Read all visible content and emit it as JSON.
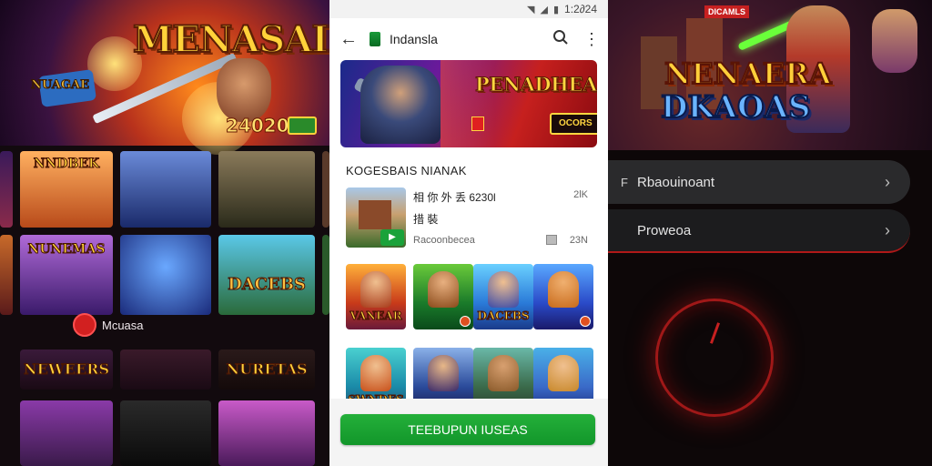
{
  "status_bar": {
    "time": "1:2∂24"
  },
  "app_bar": {
    "back_icon": "arrow-left-icon",
    "title": "Indansla",
    "search_icon": "search-icon",
    "more_icon": "more-vert-icon"
  },
  "banner": {
    "title": "PENADHEAN",
    "button": "OCORS"
  },
  "section": {
    "title": "KOGESBAIS NIANAK"
  },
  "featured": {
    "title": "相 你 外 丢 6230l",
    "subtitle": "措 裝",
    "developer": "Racoonbecea",
    "size": "2lK",
    "age": "23N"
  },
  "games": [
    {
      "title": "VANEAR"
    },
    {
      "title": ""
    },
    {
      "title": "DACEBS"
    },
    {
      "title": ""
    },
    {
      "title": "SWNDES"
    },
    {
      "title": ""
    },
    {
      "title": ""
    },
    {
      "title": ""
    }
  ],
  "install_button": {
    "label": "TEEBUPUN IUSEAS"
  },
  "left_background": {
    "hero_title": "MENASAII",
    "hero_score": "24020",
    "hero_mini": "NUAGAE",
    "tiles": [
      "NNDBEK",
      "",
      "",
      "",
      "DACEBS",
      "",
      "NUNEMAS",
      "",
      "NEWEERS",
      "",
      "NURETAS",
      ""
    ],
    "notice_text": "Mcuasa"
  },
  "right_background": {
    "tag": "DICAMLS",
    "hero_title_1": "NENAERA",
    "hero_title_2": "DKAOAS",
    "menu": [
      {
        "icon_text": "F",
        "label": "Rbaouinoant"
      },
      {
        "icon_text": "",
        "label": "Proweoa"
      }
    ]
  },
  "colors": {
    "accent_green": "#12962a",
    "brand_red": "#c62020",
    "gold": "#ffd640"
  }
}
